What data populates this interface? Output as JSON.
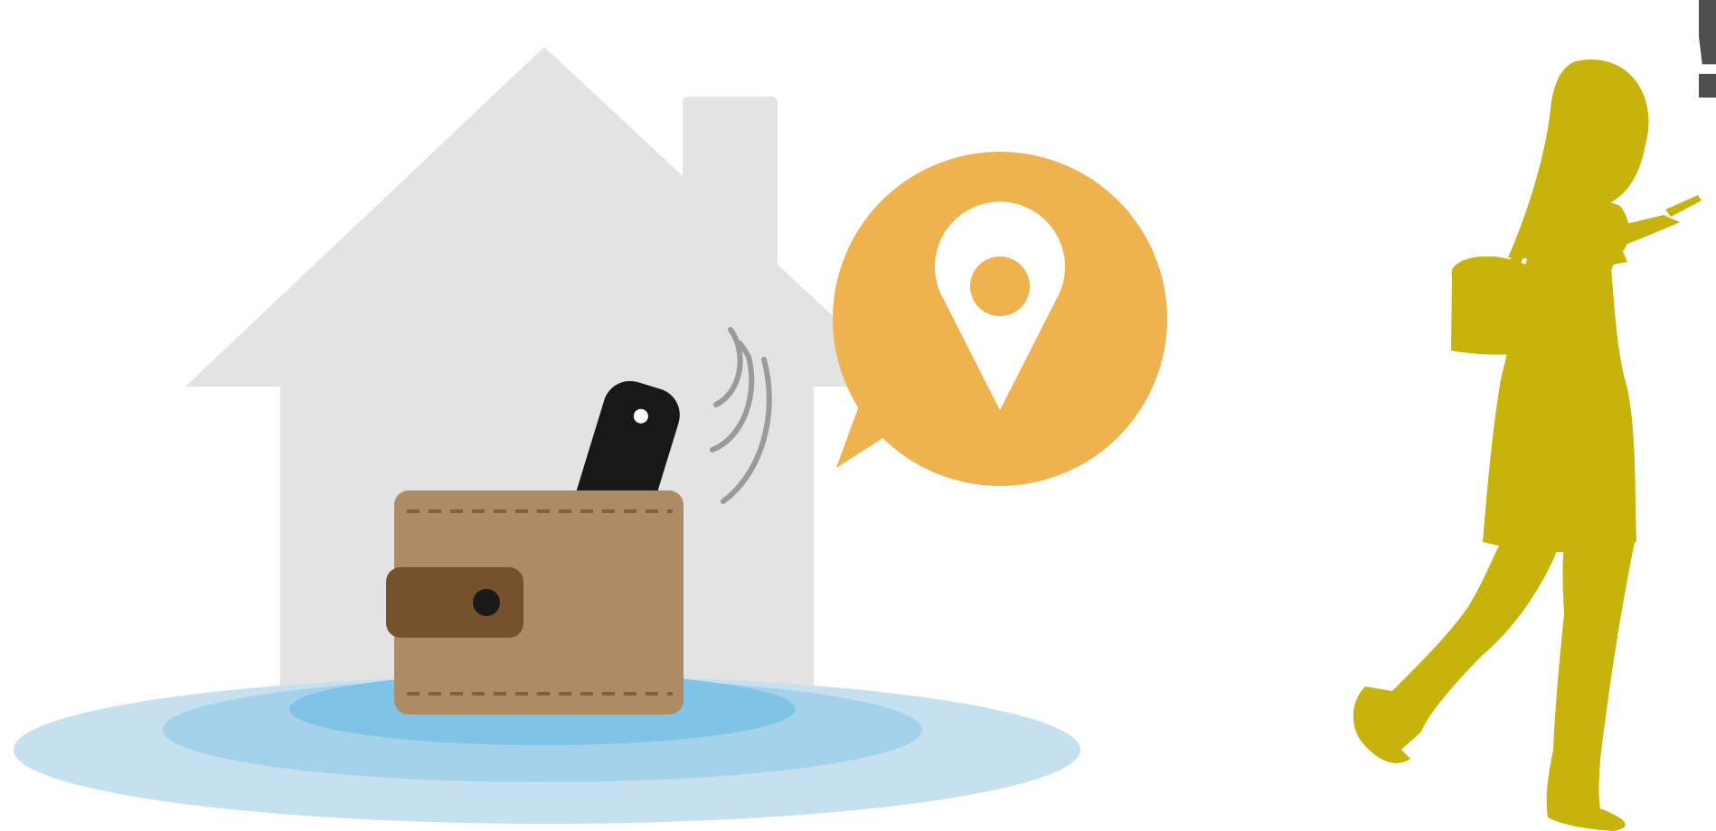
{
  "scene": {
    "description_label": "",
    "alert_mark": "!",
    "icons": {
      "house": "house-icon",
      "ripple": "ripple-rings",
      "wallet": "wallet-icon",
      "tag": "tracker-tag-icon",
      "signal": "signal-waves-icon",
      "bubble": "speech-bubble-icon",
      "pin": "location-pin-icon",
      "person": "woman-walking-with-phone-icon"
    },
    "colors": {
      "background": "#ffffff",
      "house": "#e3e3e3",
      "ripple_outer": "#c5e1f0",
      "ripple_mid": "#a4d2ea",
      "ripple_inner": "#7fc3e6",
      "wallet": "#ad8b64",
      "wallet_strap": "#76512e",
      "tag": "#181818",
      "signal": "#9a9a9a",
      "bubble": "#eeb24e",
      "pin": "#ffffff",
      "person": "#c8b20c",
      "alert": "#4e4e4e"
    }
  }
}
